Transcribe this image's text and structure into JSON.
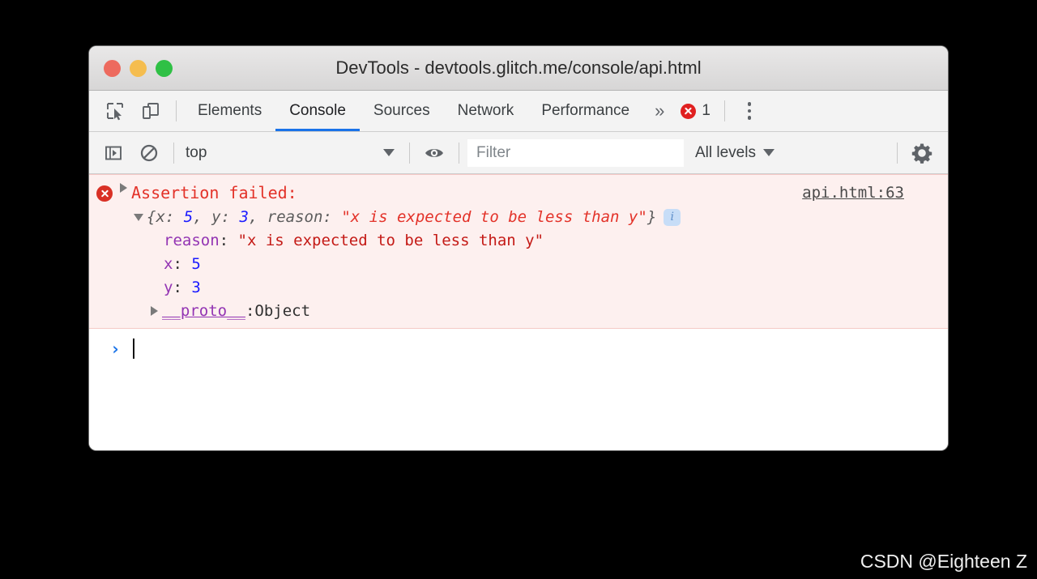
{
  "window": {
    "title": "DevTools - devtools.glitch.me/console/api.html",
    "traffic_lights": [
      "close",
      "minimize",
      "maximize"
    ]
  },
  "tabbar": {
    "inspect_icon": "inspect-element-icon",
    "device_icon": "device-toolbar-icon",
    "tabs": [
      {
        "label": "Elements",
        "active": false
      },
      {
        "label": "Console",
        "active": true
      },
      {
        "label": "Sources",
        "active": false
      },
      {
        "label": "Network",
        "active": false
      },
      {
        "label": "Performance",
        "active": false
      }
    ],
    "overflow_label": "»",
    "error_count": "1",
    "menu_icon": "more-vertical-icon"
  },
  "console_toolbar": {
    "sidebar_icon": "show-console-sidebar-icon",
    "clear_icon": "clear-console-icon",
    "context_value": "top",
    "eye_icon": "live-expression-eye-icon",
    "filter_placeholder": "Filter",
    "filter_value": "",
    "levels_label": "All levels",
    "settings_icon": "gear-icon"
  },
  "console": {
    "error": {
      "icon": "error-icon",
      "title": "Assertion failed:",
      "source_link": "api.html:63",
      "preview": {
        "open_brace": "{",
        "key_x": "x: ",
        "val_x": "5",
        "sep1": ", ",
        "key_y": "y: ",
        "val_y": "3",
        "sep2": ", ",
        "key_reason": "reason: ",
        "val_reason": "\"x is expected to be less than y\"",
        "close_brace": "}"
      },
      "info_badge": "i",
      "properties": [
        {
          "key": "reason",
          "sep": ": ",
          "value": "\"x is expected to be less than y\"",
          "type": "string"
        },
        {
          "key": "x",
          "sep": ": ",
          "value": "5",
          "type": "number"
        },
        {
          "key": "y",
          "sep": ": ",
          "value": "3",
          "type": "number"
        }
      ],
      "proto": {
        "key": "__proto__",
        "sep": ": ",
        "value": "Object"
      }
    },
    "prompt_chevron": "›"
  },
  "watermark": "CSDN @Eighteen Z",
  "colors": {
    "error_red": "#e33229",
    "string_red": "#c41a16",
    "number_blue": "#1a1aff",
    "property_purple": "#9334b3",
    "accent_blue": "#1a73e8",
    "error_bg": "#fdf0ef"
  }
}
